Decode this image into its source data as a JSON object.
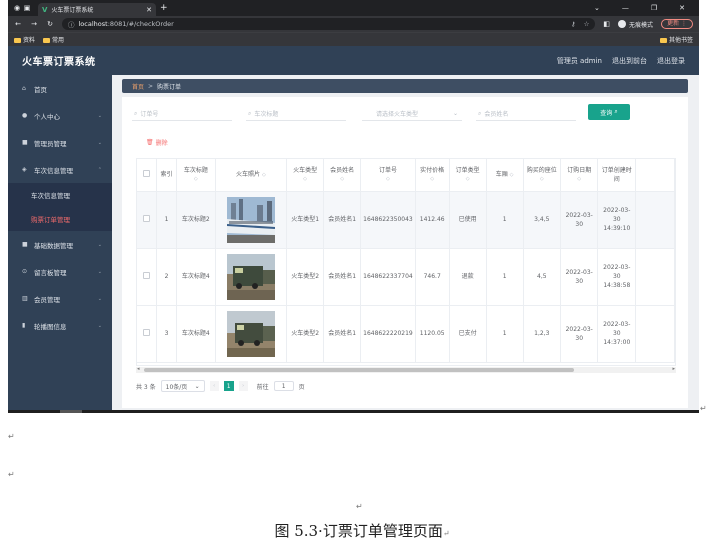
{
  "browser": {
    "tab_title": "火车票订票系统",
    "url_host": "localhost",
    "url_path": ":8081/#/checkOrder",
    "incognito": "无痕模式",
    "update": "更新",
    "bookmarks": [
      "资料",
      "常用"
    ],
    "bookmarks_right": "其他书签"
  },
  "app": {
    "brand": "火车票订票系统",
    "user": "管理员 admin",
    "back_link": "退出到前台",
    "logout": "退出登录"
  },
  "sidebar": {
    "items": [
      {
        "label": "首页",
        "icon": "home-icon"
      },
      {
        "label": "个人中心",
        "icon": "user-icon"
      },
      {
        "label": "管理员管理",
        "icon": "manage-icon"
      },
      {
        "label": "车次信息管理",
        "icon": "train-icon"
      }
    ],
    "subitems": [
      {
        "label": "车次信息管理"
      },
      {
        "label": "购票订单管理"
      }
    ],
    "items2": [
      {
        "label": "基础数据管理",
        "icon": "data-icon"
      },
      {
        "label": "留言板管理",
        "icon": "message-icon"
      },
      {
        "label": "会员管理",
        "icon": "member-icon"
      },
      {
        "label": "轮播图信息",
        "icon": "carousel-icon"
      }
    ]
  },
  "breadcrumb": {
    "home": "首页",
    "sep": ">",
    "current": "购票订单"
  },
  "filters": {
    "order_no": "订单号",
    "train_title": "车次标题",
    "train_type": "请选择火车类型",
    "member_name": "会员姓名",
    "query": "查询"
  },
  "delete_label": "删除",
  "table": {
    "headers": [
      "索引",
      "车次标题",
      "火车照片",
      "火车类型",
      "会员姓名",
      "订单号",
      "实付价格",
      "订单类型",
      "车厢",
      "购买的座位",
      "订购日期",
      "订单创建时间"
    ],
    "sort_glyph": "◇",
    "rows": [
      {
        "idx": "1",
        "title": "车次标题2",
        "type": "火车类型1",
        "member": "会员姓名1",
        "order": "1648622350043",
        "price": "1412.46",
        "status": "已使用",
        "car": "1",
        "seats": "3,4,5",
        "date": "2022-03-30",
        "created": "2022-03-30 14:39:10"
      },
      {
        "idx": "2",
        "title": "车次标题4",
        "type": "火车类型2",
        "member": "会员姓名1",
        "order": "1648622337704",
        "price": "746.7",
        "status": "退款",
        "car": "1",
        "seats": "4,5",
        "date": "2022-03-30",
        "created": "2022-03-30 14:38:58"
      },
      {
        "idx": "3",
        "title": "车次标题4",
        "type": "火车类型2",
        "member": "会员姓名1",
        "order": "1648622220219",
        "price": "1120.05",
        "status": "已支付",
        "car": "1",
        "seats": "1,2,3",
        "date": "2022-03-30",
        "created": "2022-03-30 14:37:00"
      }
    ]
  },
  "pager": {
    "total": "共 3 条",
    "page_size": "10条/页",
    "current": "1",
    "goto": "前往",
    "goto_value": "1",
    "page_unit": "页"
  },
  "doc": {
    "pilcrow": "↵",
    "caption": "图 5.3·订票订单管理页面"
  },
  "colors": {
    "sidebar": "#304156",
    "accent": "#18a38c",
    "active": "#f56c6c"
  }
}
